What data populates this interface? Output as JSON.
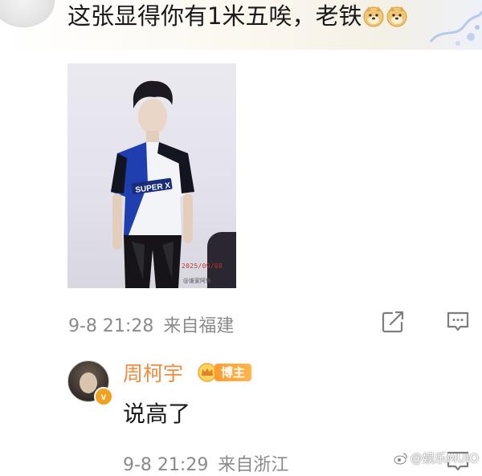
{
  "top_comment": {
    "text": "这张显得你有1米五唉，老铁",
    "emoji_icon": "doge-icon",
    "timestamp": "9-8 21:28",
    "location": "来自福建"
  },
  "photo": {
    "shirt_text": "SUPER X",
    "stamp": "2025/09/08",
    "watermark": "@谁家阿鲁"
  },
  "reply": {
    "author": "周柯宇",
    "badge": "博主",
    "verified_mark": "v",
    "text": "说高了",
    "timestamp": "9-8 21:29",
    "location": "来自浙江"
  },
  "watermark": "@娱乐MUIO",
  "colors": {
    "author_name": "#f08a3c",
    "badge_bg": "#ff9b2f",
    "meta_text": "#8a8a8a",
    "verified": "#f2a01e"
  }
}
